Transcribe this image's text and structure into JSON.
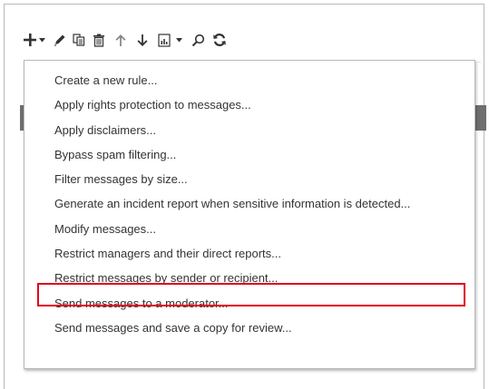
{
  "toolbar": {
    "icons": [
      "add-icon",
      "dropdown-caret-icon",
      "edit-pencil-icon",
      "copy-icon",
      "delete-trash-icon",
      "move-up-arrow-icon",
      "move-down-arrow-icon",
      "report-icon",
      "dropdown-caret-icon",
      "search-icon",
      "refresh-icon"
    ]
  },
  "menu": {
    "items": [
      {
        "label": "Create a new rule..."
      },
      {
        "label": "Apply rights protection to messages..."
      },
      {
        "label": "Apply disclaimers..."
      },
      {
        "label": "Bypass spam filtering..."
      },
      {
        "label": "Filter messages by size..."
      },
      {
        "label": "Generate an incident report when sensitive information is detected..."
      },
      {
        "label": "Modify messages..."
      },
      {
        "label": "Restrict managers and their direct reports..."
      },
      {
        "label": "Restrict messages by sender or recipient..."
      },
      {
        "label": "Send messages to a moderator..."
      },
      {
        "label": "Send messages and save a copy for review..."
      }
    ],
    "highlighted_index": 8
  },
  "colors": {
    "icon": "#333333",
    "highlight_border": "#e0001b",
    "gray_bar": "#6f6f6f",
    "menu_text": "#333333"
  }
}
